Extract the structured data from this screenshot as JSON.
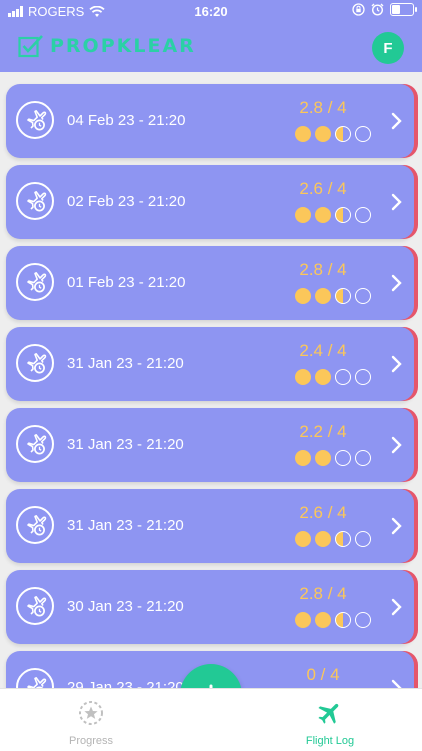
{
  "status_bar": {
    "carrier": "ROGERS",
    "time": "16:20",
    "battery_level": 0.45
  },
  "header": {
    "logo_text": "PROPKLEAR",
    "avatar_initial": "F"
  },
  "colors": {
    "primary": "#8e95f2",
    "accent_green": "#22c995",
    "score_yellow": "#fbc75a",
    "edge_red": "#e5566b"
  },
  "flights": [
    {
      "date": "04 Feb 23 - 21:20",
      "score": "2.8 / 4",
      "rating": 2.5
    },
    {
      "date": "02 Feb 23 - 21:20",
      "score": "2.6 / 4",
      "rating": 2.5
    },
    {
      "date": "01 Feb 23 - 21:20",
      "score": "2.8 / 4",
      "rating": 2.5
    },
    {
      "date": "31 Jan 23 - 21:20",
      "score": "2.4 / 4",
      "rating": 2
    },
    {
      "date": "31 Jan 23 - 21:20",
      "score": "2.2 / 4",
      "rating": 2
    },
    {
      "date": "31 Jan 23 - 21:20",
      "score": "2.6 / 4",
      "rating": 2.5
    },
    {
      "date": "30 Jan 23 - 21:20",
      "score": "2.8 / 4",
      "rating": 2.5
    },
    {
      "date": "29 Jan 23 - 21:20",
      "score": "0 / 4",
      "rating": 0
    }
  ],
  "tabs": {
    "progress_label": "Progress",
    "flight_log_label": "Flight Log"
  },
  "fab": {
    "icon": "plus-icon"
  }
}
